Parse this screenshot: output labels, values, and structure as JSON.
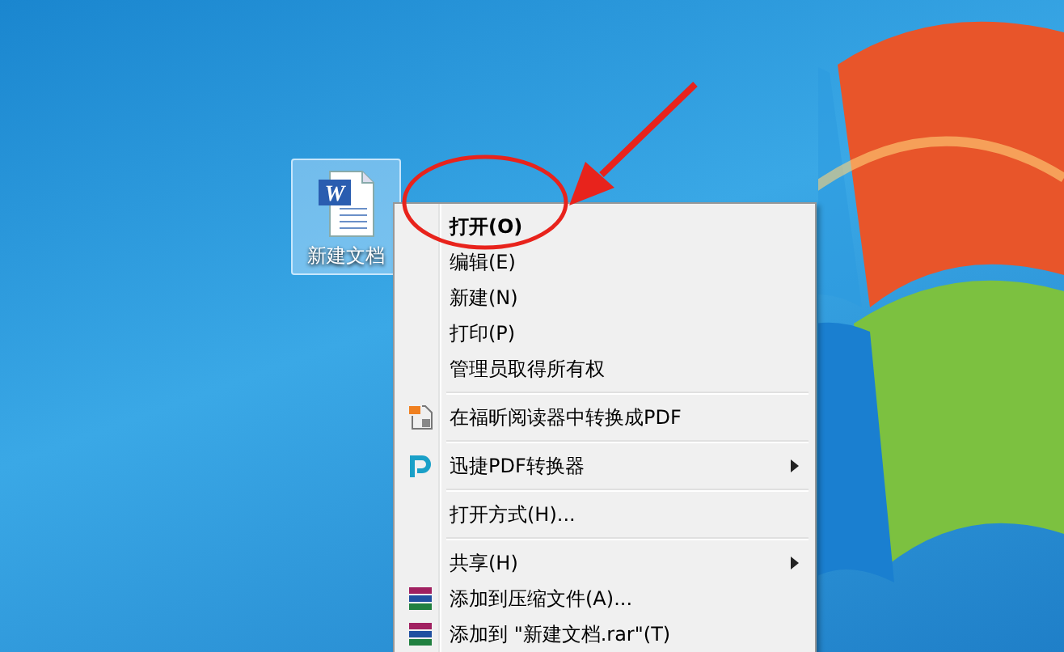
{
  "desktop": {
    "icon": {
      "badge": "W",
      "label": "新建文档",
      "selected": true
    }
  },
  "context_menu": {
    "items": [
      {
        "kind": "item",
        "label": "打开(O)",
        "default": true,
        "submenu": false
      },
      {
        "kind": "item",
        "label": "编辑(E)",
        "default": false,
        "submenu": false
      },
      {
        "kind": "item",
        "label": "新建(N)",
        "default": false,
        "submenu": false
      },
      {
        "kind": "item",
        "label": "打印(P)",
        "default": false,
        "submenu": false
      },
      {
        "kind": "item",
        "label": "管理员取得所有权",
        "default": false,
        "submenu": false
      },
      {
        "kind": "separator"
      },
      {
        "kind": "item",
        "label": "在福昕阅读器中转换成PDF",
        "default": false,
        "submenu": false
      },
      {
        "kind": "separator"
      },
      {
        "kind": "item",
        "label": "迅捷PDF转换器",
        "default": false,
        "submenu": true
      },
      {
        "kind": "separator"
      },
      {
        "kind": "item",
        "label": "打开方式(H)...",
        "default": false,
        "submenu": false
      },
      {
        "kind": "separator"
      },
      {
        "kind": "item",
        "label": "共享(H)",
        "default": false,
        "submenu": true
      },
      {
        "kind": "item",
        "label": "添加到压缩文件(A)...",
        "default": false,
        "submenu": false
      },
      {
        "kind": "item",
        "label": "添加到 \"新建文档.rar\"(T)",
        "default": false,
        "submenu": false
      }
    ]
  }
}
